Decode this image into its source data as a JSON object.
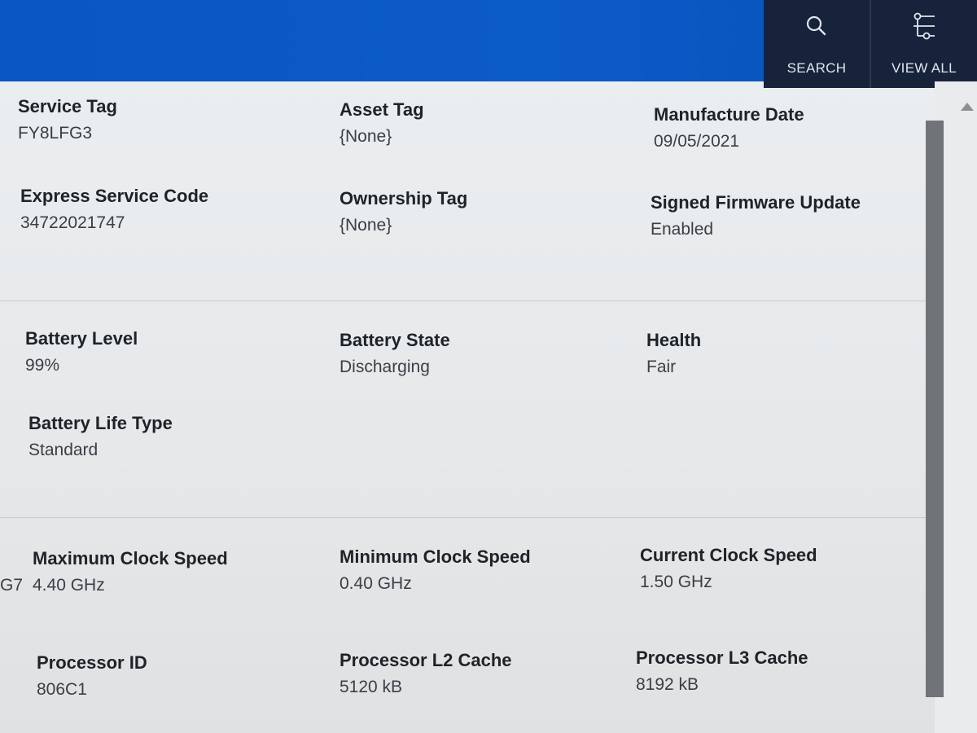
{
  "header": {
    "search_label": "SEARCH",
    "view_all_label": "VIEW ALL",
    "search_icon": "search-icon",
    "view_all_icon": "filter-list-icon",
    "bar_color": "#0a56c4",
    "actions_color": "#16233a"
  },
  "system": {
    "service_tag": {
      "label": "Service Tag",
      "value": "FY8LFG3"
    },
    "asset_tag": {
      "label": "Asset Tag",
      "value": "{None}"
    },
    "manufacture_date": {
      "label": "Manufacture Date",
      "value": "09/05/2021"
    },
    "express_service_code": {
      "label": "Express Service Code",
      "value": "34722021747"
    },
    "ownership_tag": {
      "label": "Ownership Tag",
      "value": "{None}"
    },
    "signed_firmware_update": {
      "label": "Signed Firmware Update",
      "value": "Enabled"
    }
  },
  "battery": {
    "level": {
      "label": "Battery Level",
      "value": "99%"
    },
    "state": {
      "label": "Battery State",
      "value": "Discharging"
    },
    "health": {
      "label": "Health",
      "value": "Fair"
    },
    "life_type": {
      "label": "Battery Life Type",
      "value": "Standard"
    }
  },
  "processor": {
    "stray_text": "G7",
    "max_clock": {
      "label": "Maximum Clock Speed",
      "value": "4.40 GHz"
    },
    "min_clock": {
      "label": "Minimum Clock Speed",
      "value": "0.40 GHz"
    },
    "current_clock": {
      "label": "Current Clock Speed",
      "value": "1.50 GHz"
    },
    "id": {
      "label": "Processor ID",
      "value": "806C1"
    },
    "l2_cache": {
      "label": "Processor L2 Cache",
      "value": "5120 kB"
    },
    "l3_cache": {
      "label": "Processor L3 Cache",
      "value": "8192 kB"
    }
  }
}
